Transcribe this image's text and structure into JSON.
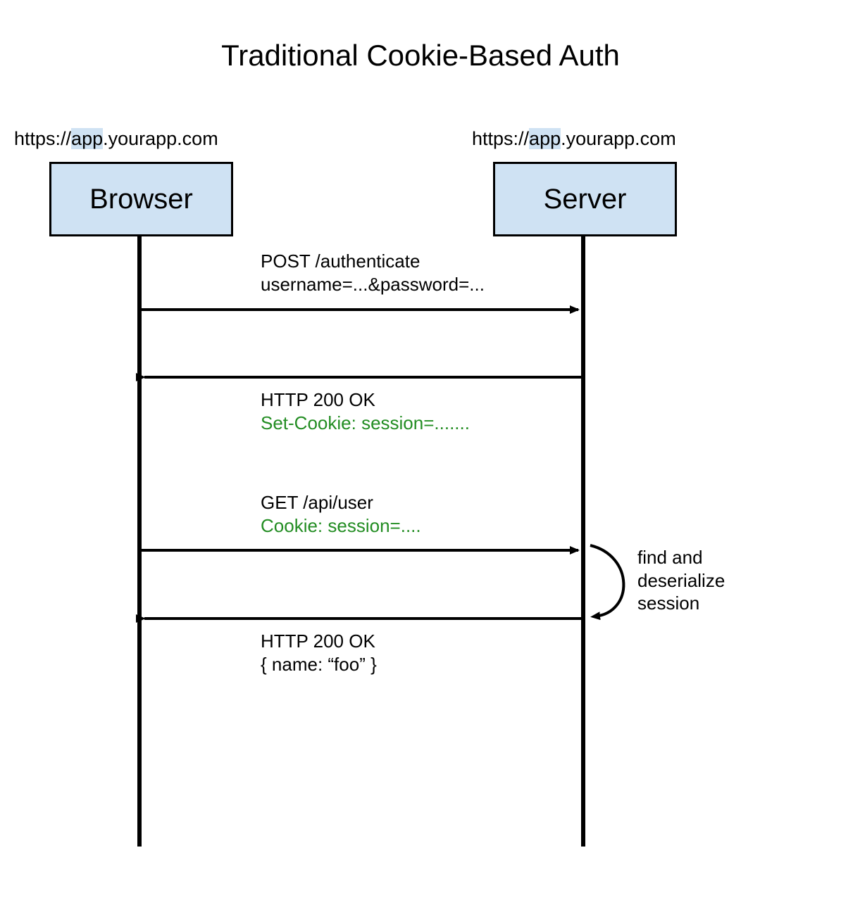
{
  "title": "Traditional Cookie-Based Auth",
  "browser": {
    "url_prefix": "https://",
    "url_highlight": "app",
    "url_suffix": ".yourapp.com",
    "label": "Browser"
  },
  "server": {
    "url_prefix": "https://",
    "url_highlight": "app",
    "url_suffix": ".yourapp.com",
    "label": "Server"
  },
  "messages": {
    "m1_line1": "POST /authenticate",
    "m1_line2": "username=...&password=...",
    "m2_line1": "HTTP 200 OK",
    "m2_line2": "Set-Cookie: session=.......",
    "m3_line1": "GET /api/user",
    "m3_line2": "Cookie: session=....",
    "m4_line1": "HTTP 200 OK",
    "m4_line2": "{  name: “foo” }"
  },
  "side_note": {
    "line1": "find and",
    "line2": "deserialize",
    "line3": "session"
  }
}
